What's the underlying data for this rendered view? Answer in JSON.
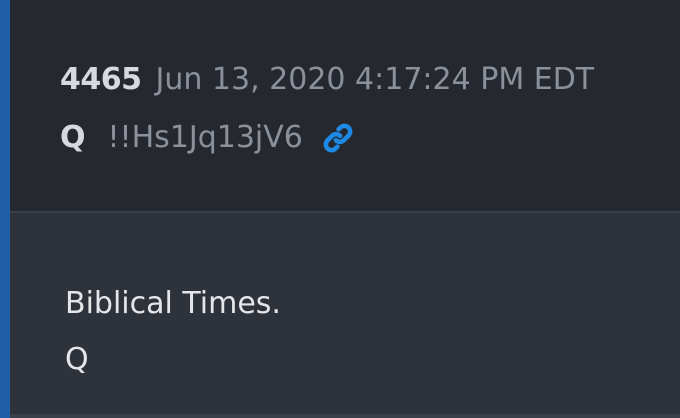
{
  "post": {
    "number": "4465",
    "date": "Jun 13, 2020 4:17:24 PM EDT",
    "author": "Q",
    "tripcode": "!!Hs1Jq13jV6",
    "link_icon": "link-icon",
    "body_lines": [
      "Biblical Times.",
      "Q"
    ]
  },
  "colors": {
    "accent": "#1f5fa6",
    "link": "#1e88e5",
    "header_bg": "#25292f",
    "body_bg": "#2e333b"
  }
}
